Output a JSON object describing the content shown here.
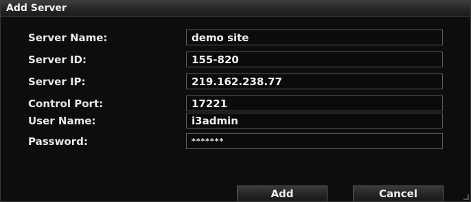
{
  "dialog": {
    "title": "Add Server"
  },
  "fields": [
    {
      "label": "Server Name:",
      "value": "demo site"
    },
    {
      "label": "Server ID:",
      "value": "155-820"
    },
    {
      "label": "Server IP:",
      "value": "219.162.238.77"
    },
    {
      "label": "Control Port:",
      "value": "17221"
    },
    {
      "label": "User Name:",
      "value": "i3admin"
    },
    {
      "label": "Password:",
      "value": "*******"
    }
  ],
  "buttons": {
    "add": "Add",
    "cancel": "Cancel"
  }
}
